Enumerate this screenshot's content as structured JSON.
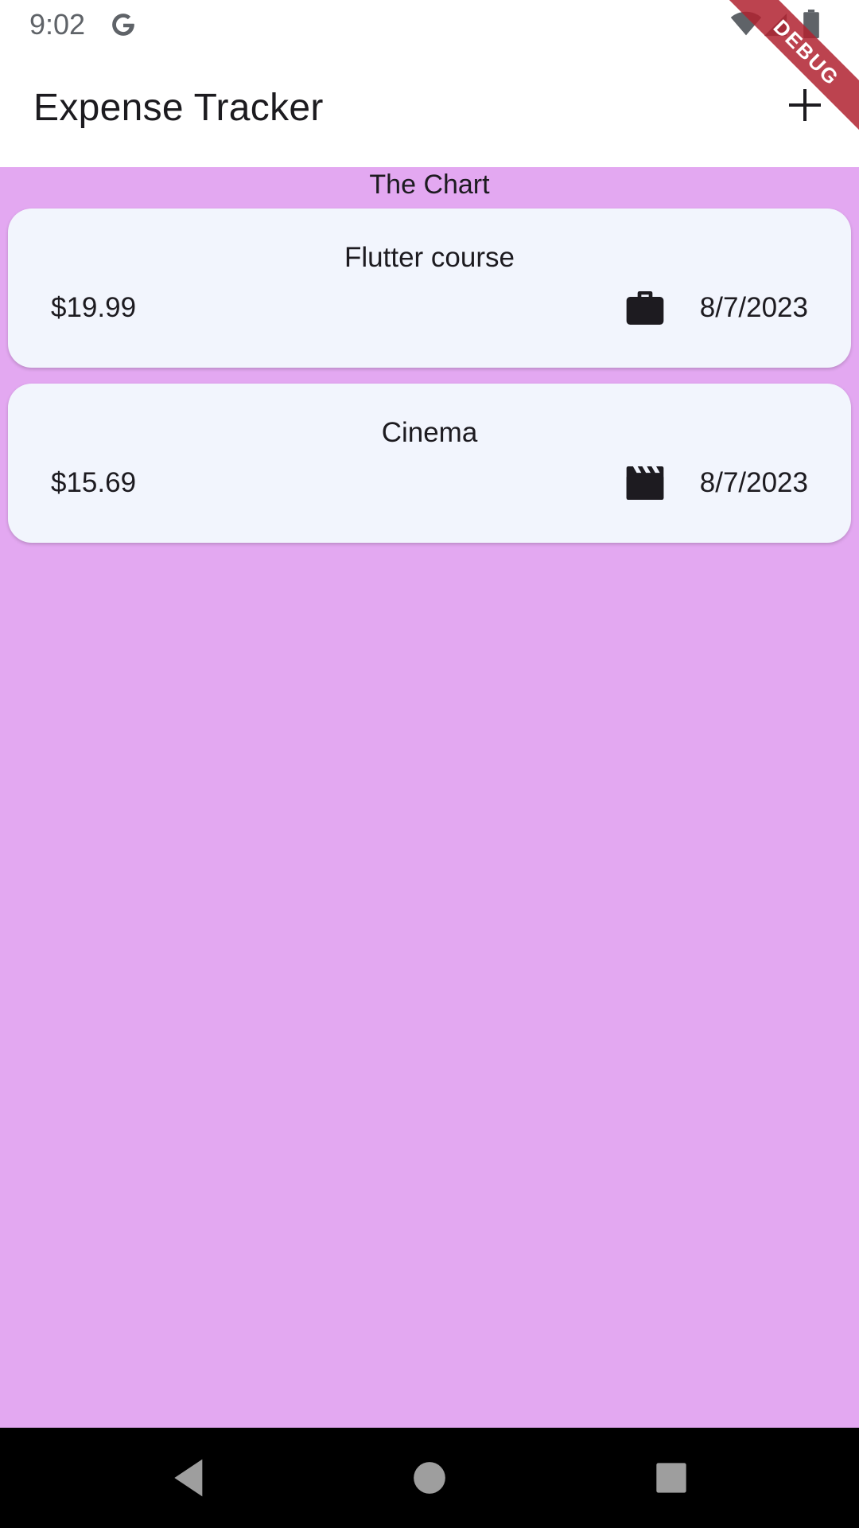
{
  "status_bar": {
    "time": "9:02",
    "icons": [
      "google-icon",
      "wifi-icon",
      "signal-icon",
      "battery-icon"
    ]
  },
  "debug_banner": {
    "label": "DEBUG"
  },
  "app_bar": {
    "title": "Expense Tracker",
    "add_icon": "plus-icon"
  },
  "main": {
    "chart_placeholder": "The Chart",
    "expenses": [
      {
        "title": "Flutter course",
        "amount": "$19.99",
        "category_icon": "briefcase-icon",
        "date": "8/7/2023"
      },
      {
        "title": "Cinema",
        "amount": "$15.69",
        "category_icon": "movie-clapperboard-icon",
        "date": "8/7/2023"
      }
    ]
  },
  "nav_bar": {
    "buttons": [
      "back-icon",
      "home-icon",
      "recents-icon"
    ]
  },
  "colors": {
    "background": "#e3a8f1",
    "card": "#f2f5fd",
    "text": "#1d1b20",
    "debug_ribbon": "#b02230"
  }
}
